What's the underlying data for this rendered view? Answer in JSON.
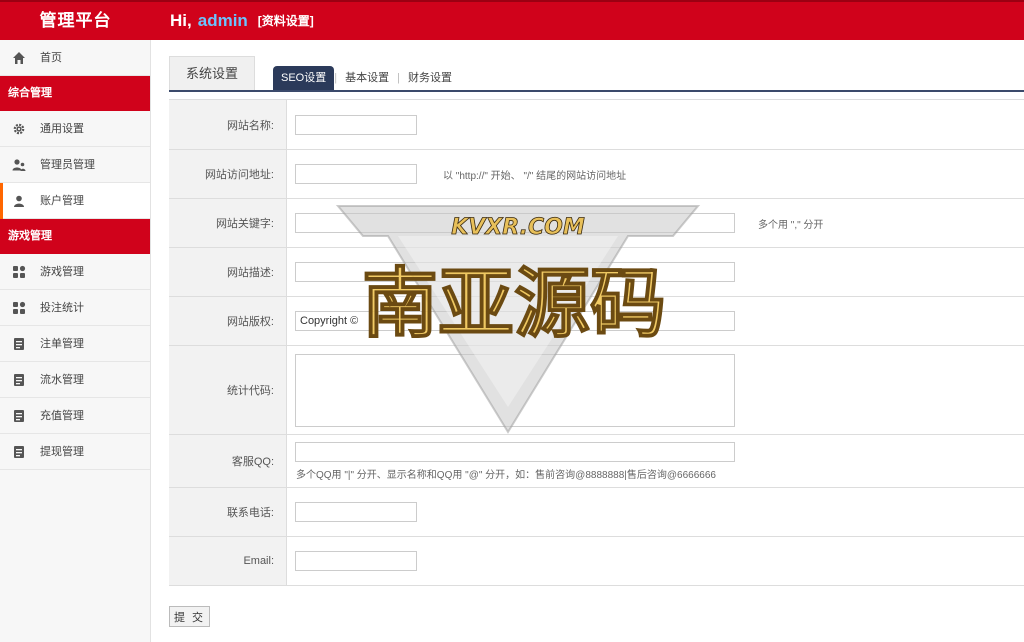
{
  "header": {
    "brand": "管理平台",
    "greeting": "Hi,",
    "username": "admin",
    "profile_link": "[资料设置]"
  },
  "sidebar": {
    "home": "首页",
    "group1": "综合管理",
    "items1": [
      "通用设置",
      "管理员管理",
      "账户管理"
    ],
    "group2": "游戏管理",
    "items2": [
      "游戏管理",
      "投注统计",
      "注单管理",
      "流水管理",
      "充值管理",
      "提现管理"
    ]
  },
  "tabs": {
    "title": "系统设置",
    "seo": "SEO设置",
    "basic": "基本设置",
    "finance": "财务设置",
    "separator": "|"
  },
  "form": {
    "site_name_label": "网站名称:",
    "site_url_label": "网站访问地址:",
    "site_url_hint": "以 \"http://\" 开始、 \"/\" 结尾的网站访问地址",
    "keywords_label": "网站关键字:",
    "keywords_hint": "多个用 \",\" 分开",
    "desc_label": "网站描述:",
    "copyright_label": "网站版权:",
    "copyright_value": "Copyright ©",
    "stats_label": "统计代码:",
    "qq_label": "客服QQ:",
    "qq_hint": "多个QQ用 \"|\" 分开、显示名称和QQ用 \"@\" 分开，如：售前咨询@8888888|售后咨询@6666666",
    "phone_label": "联系电话:",
    "email_label": "Email:",
    "submit": "提 交"
  },
  "watermark": {
    "top_text": "KVXR.COM",
    "main_text": "南亚源码"
  },
  "colors": {
    "header_red": "#d0021b",
    "active_accent": "#ff6600",
    "tab_navy": "#2b3a5a",
    "username_blue": "#6cc3ff"
  }
}
